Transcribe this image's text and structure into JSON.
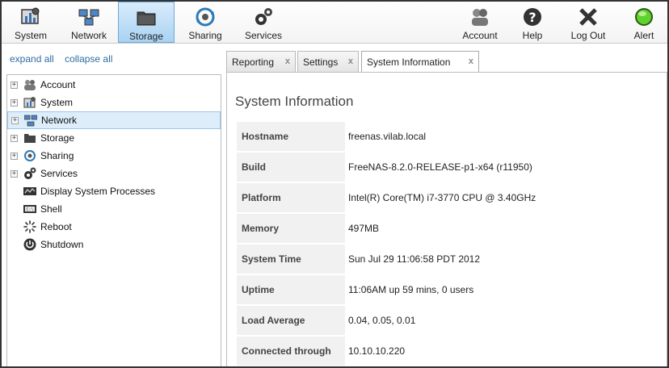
{
  "toolbar": {
    "left": [
      {
        "label": "System",
        "icon": "system-icon"
      },
      {
        "label": "Network",
        "icon": "network-icon"
      },
      {
        "label": "Storage",
        "icon": "storage-icon",
        "active": true
      },
      {
        "label": "Sharing",
        "icon": "sharing-icon"
      },
      {
        "label": "Services",
        "icon": "services-icon"
      }
    ],
    "right": [
      {
        "label": "Account",
        "icon": "account-icon"
      },
      {
        "label": "Help",
        "icon": "help-icon"
      },
      {
        "label": "Log Out",
        "icon": "logout-icon"
      },
      {
        "label": "Alert",
        "icon": "alert-icon"
      }
    ]
  },
  "sidebar": {
    "expand_all": "expand all",
    "collapse_all": "collapse all",
    "items": [
      {
        "label": "Account",
        "icon": "account-icon",
        "expandable": true
      },
      {
        "label": "System",
        "icon": "system-icon",
        "expandable": true
      },
      {
        "label": "Network",
        "icon": "network-icon",
        "expandable": true,
        "selected": true
      },
      {
        "label": "Storage",
        "icon": "storage-icon",
        "expandable": true
      },
      {
        "label": "Sharing",
        "icon": "sharing-icon",
        "expandable": true
      },
      {
        "label": "Services",
        "icon": "services-icon",
        "expandable": true
      },
      {
        "label": "Display System Processes",
        "icon": "processes-icon",
        "expandable": false
      },
      {
        "label": "Shell",
        "icon": "shell-icon",
        "expandable": false
      },
      {
        "label": "Reboot",
        "icon": "reboot-icon",
        "expandable": false
      },
      {
        "label": "Shutdown",
        "icon": "shutdown-icon",
        "expandable": false
      }
    ]
  },
  "tabs": [
    {
      "label": "Reporting",
      "close": "x"
    },
    {
      "label": "Settings",
      "close": "x"
    },
    {
      "label": "System Information",
      "close": "x",
      "active": true
    }
  ],
  "system_info": {
    "title": "System Information",
    "rows": [
      {
        "key": "Hostname",
        "value": "freenas.vilab.local"
      },
      {
        "key": "Build",
        "value": "FreeNAS-8.2.0-RELEASE-p1-x64 (r11950)"
      },
      {
        "key": "Platform",
        "value": "Intel(R) Core(TM) i7-3770 CPU @ 3.40GHz"
      },
      {
        "key": "Memory",
        "value": "497MB"
      },
      {
        "key": "System Time",
        "value": "Sun Jul 29 11:06:58 PDT 2012"
      },
      {
        "key": "Uptime",
        "value": "11:06AM up 59 mins, 0 users"
      },
      {
        "key": "Load Average",
        "value": "0.04, 0.05, 0.01"
      },
      {
        "key": "Connected through",
        "value": "10.10.10.220"
      }
    ]
  },
  "colors": {
    "active_tab_bg": "#a9d2f3",
    "link": "#2e6da4",
    "selected_row": "#ddeefa",
    "alert_green": "#5fd22e"
  }
}
